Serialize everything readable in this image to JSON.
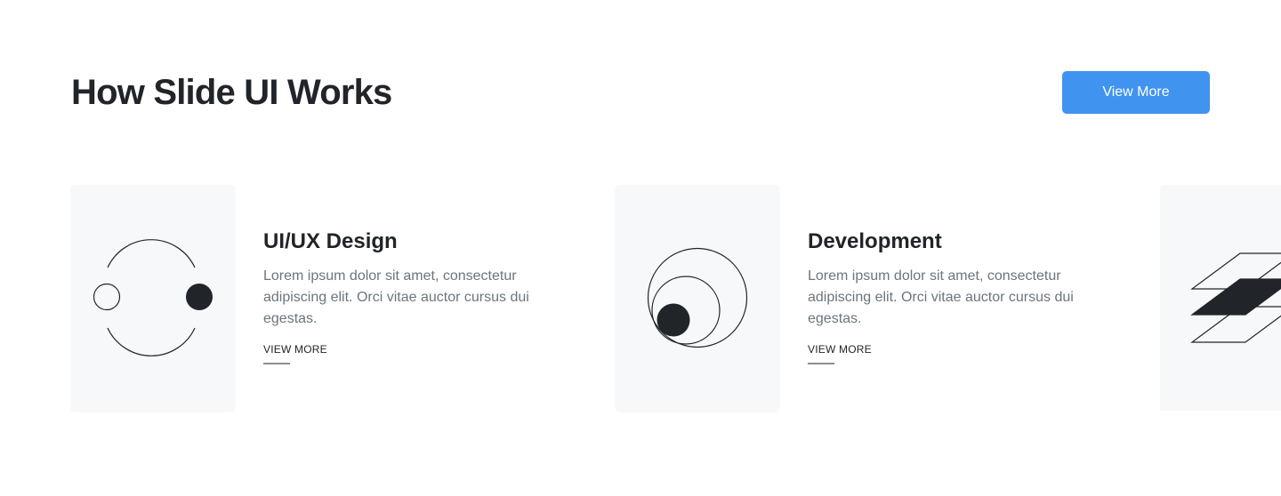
{
  "header": {
    "title": "How Slide UI Works",
    "button_label": "View More"
  },
  "cards": [
    {
      "icon": "split-circles-icon",
      "title": "UI/UX Design",
      "description": "Lorem ipsum dolor sit amet, consectetur adipiscing elit. Orci vitae auctor cursus dui egestas.",
      "link_label": "VIEW MORE"
    },
    {
      "icon": "nested-circles-icon",
      "title": "Development",
      "description": "Lorem ipsum dolor sit amet, consectetur adipiscing elit. Orci vitae auctor cursus dui egestas.",
      "link_label": "VIEW MORE"
    },
    {
      "icon": "stacked-layers-icon"
    }
  ],
  "colors": {
    "accent": "#4094f0",
    "heading": "#212529",
    "body_text": "#6c757d",
    "card_background": "#f7f8f9"
  }
}
